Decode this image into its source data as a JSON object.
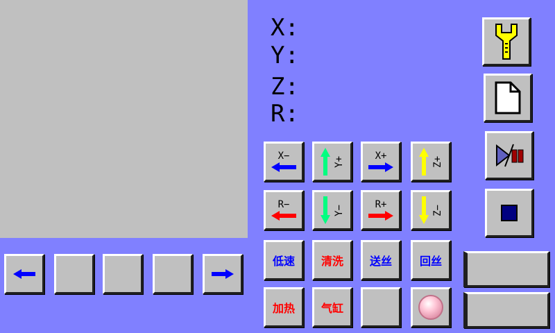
{
  "coords": {
    "x_label": "X:",
    "y_label": "Y:",
    "z_label": "Z:",
    "r_label": "R:"
  },
  "jog": {
    "x_minus": "X−",
    "y_plus": "Y+",
    "x_plus": "X+",
    "z_plus": "Z+",
    "r_minus": "R−",
    "y_minus": "Y−",
    "r_plus": "R+",
    "z_minus": "Z−"
  },
  "functions": {
    "low_speed": "低速",
    "clean": "清洗",
    "feed_wire": "送丝",
    "retract_wire": "回丝",
    "heat": "加热",
    "cylinder": "气缸"
  },
  "colors": {
    "background": "#8080ff",
    "panel": "#c0c0c0",
    "blue_arrow": "#0000ff",
    "red_arrow": "#ff0000",
    "green_arrow": "#00ff80",
    "yellow_arrow": "#ffff00",
    "text_blue": "#0000ff",
    "text_red": "#ff0000"
  },
  "icons": {
    "settings": "wrench-icon",
    "file": "document-icon",
    "run_pause": "play-pause-icon",
    "stop": "stop-icon",
    "indicator": "pink-circle-icon",
    "prev": "left-arrow-icon",
    "next": "right-arrow-icon"
  }
}
